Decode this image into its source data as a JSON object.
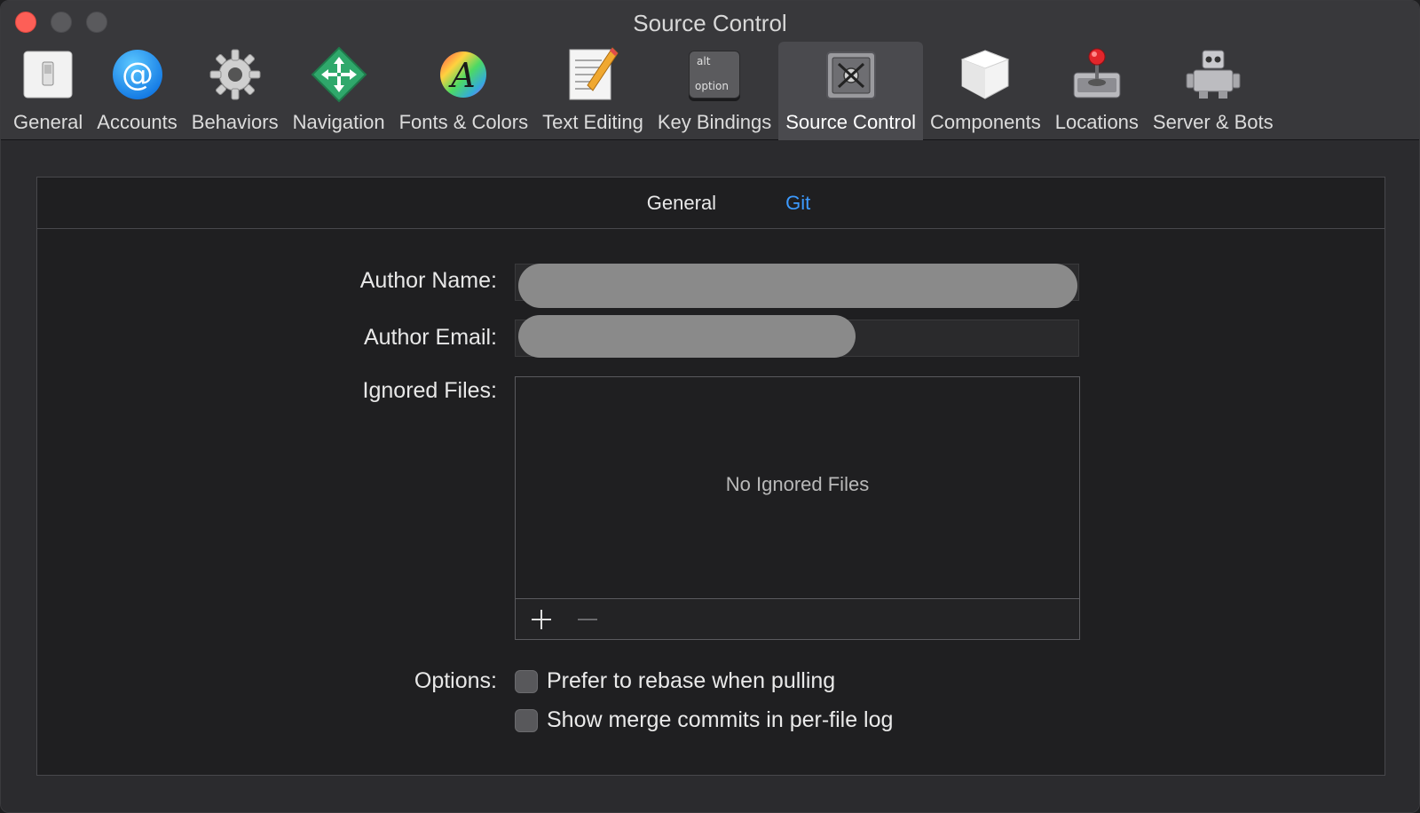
{
  "window": {
    "title": "Source Control"
  },
  "toolbar": {
    "items": [
      {
        "label": "General",
        "icon": "switch-icon"
      },
      {
        "label": "Accounts",
        "icon": "at-sign-icon"
      },
      {
        "label": "Behaviors",
        "icon": "gear-icon"
      },
      {
        "label": "Navigation",
        "icon": "navigation-arrows-icon"
      },
      {
        "label": "Fonts & Colors",
        "icon": "font-color-wheel-icon"
      },
      {
        "label": "Text Editing",
        "icon": "pencil-document-icon"
      },
      {
        "label": "Key Bindings",
        "icon": "option-key-icon"
      },
      {
        "label": "Source Control",
        "icon": "safe-icon",
        "active": true
      },
      {
        "label": "Components",
        "icon": "package-icon"
      },
      {
        "label": "Locations",
        "icon": "disk-joystick-icon"
      },
      {
        "label": "Server & Bots",
        "icon": "robot-icon"
      }
    ],
    "option_key_top": "alt",
    "option_key_bottom": "option"
  },
  "tabs": [
    {
      "label": "General",
      "selected": false
    },
    {
      "label": "Git",
      "selected": true
    }
  ],
  "form": {
    "author_name_label": "Author Name:",
    "author_email_label": "Author Email:",
    "ignored_files_label": "Ignored Files:",
    "ignored_files_empty": "No Ignored Files",
    "options_label": "Options:",
    "options": [
      {
        "label": "Prefer to rebase when pulling",
        "checked": false
      },
      {
        "label": "Show merge commits in per-file log",
        "checked": false
      }
    ]
  },
  "colors": {
    "accent": "#3c9aff",
    "close": "#fd5f57"
  }
}
